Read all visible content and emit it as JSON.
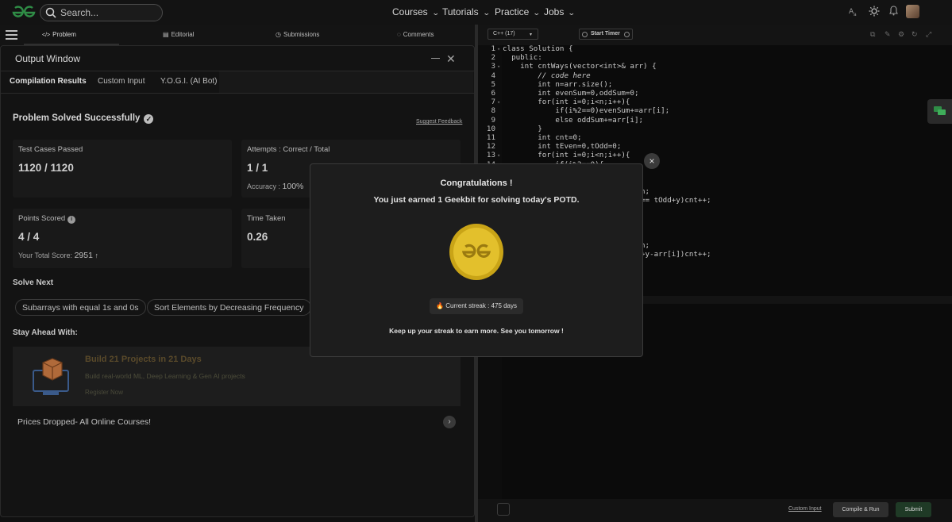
{
  "topbar": {
    "search_placeholder": "Search...",
    "nav": [
      "Courses",
      "Tutorials",
      "Practice",
      "Jobs"
    ]
  },
  "problem_tabs": [
    "Problem",
    "Editorial",
    "Submissions",
    "Comments"
  ],
  "output_window": {
    "title": "Output Window",
    "tabs": [
      "Compilation Results",
      "Custom Input",
      "Y.O.G.I. (AI Bot)"
    ],
    "status": "Problem Solved Successfully",
    "suggest_feedback": "Suggest Feedback",
    "cards": {
      "test_cases_label": "Test Cases Passed",
      "test_cases_value": "1120 / 1120",
      "attempts_label": "Attempts : Correct / Total",
      "attempts_value": "1 / 1",
      "accuracy_label": "Accuracy :",
      "accuracy_value": "100%",
      "points_label": "Points Scored",
      "points_value": "4 / 4",
      "total_score_label": "Your Total Score:",
      "total_score_value": "2951",
      "time_label": "Time Taken",
      "time_value": "0.26"
    },
    "solve_next_heading": "Solve Next",
    "solve_next": [
      "Subarrays with equal 1s and 0s",
      "Sort Elements by Decreasing Frequency"
    ],
    "stay_ahead_heading": "Stay Ahead With:",
    "banner": {
      "title": "Build 21 Projects in 21 Days",
      "subtitle": "Build real-world ML, Deep Learning & Gen AI projects",
      "cta": "Register Now"
    },
    "promo": "Prices Dropped- All Online Courses!"
  },
  "editor": {
    "language": "C++ (17)",
    "timer_label": "Start Timer",
    "lines": [
      {
        "n": "1",
        "fold": true,
        "text": "class Solution {"
      },
      {
        "n": "2",
        "fold": false,
        "text": "  public:"
      },
      {
        "n": "3",
        "fold": true,
        "text": "    int cntWays(vector<int>& arr) {"
      },
      {
        "n": "4",
        "fold": false,
        "text": "        // code here"
      },
      {
        "n": "5",
        "fold": false,
        "text": "        int n=arr.size();"
      },
      {
        "n": "6",
        "fold": false,
        "text": "        int evenSum=0,oddSum=0;"
      },
      {
        "n": "7",
        "fold": true,
        "text": "        for(int i=0;i<n;i++){"
      },
      {
        "n": "8",
        "fold": false,
        "text": "            if(i%2==0)evenSum+=arr[i];"
      },
      {
        "n": "9",
        "fold": false,
        "text": "            else oddSum+=arr[i];"
      },
      {
        "n": "10",
        "fold": false,
        "text": "        }"
      },
      {
        "n": "11",
        "fold": false,
        "text": "        int cnt=0;"
      },
      {
        "n": "12",
        "fold": false,
        "text": "        int tEven=0,tOdd=0;"
      },
      {
        "n": "13",
        "fold": true,
        "text": "        for(int i=0;i<n;i++){"
      },
      {
        "n": "14",
        "fold": true,
        "text": "            if(i%2==0){"
      }
    ],
    "hidden_fragments": [
      "n;",
      "== tOdd+y)cnt++;",
      "n;",
      "+y-arr[i])cnt++;"
    ],
    "bottom": {
      "custom_input": "Custom Input",
      "compile_run": "Compile & Run",
      "submit": "Submit"
    }
  },
  "modal": {
    "title": "Congratulations !",
    "message": "You just earned 1 Geekbit for solving today's POTD.",
    "streak": "Current streak : 475 days",
    "footer": "Keep up your streak to earn more. See you tomorrow !",
    "close_label": "×"
  },
  "colors": {
    "coin_gold": "#d9b51e",
    "submit_green": "#1f3a26",
    "background": "#101010"
  }
}
